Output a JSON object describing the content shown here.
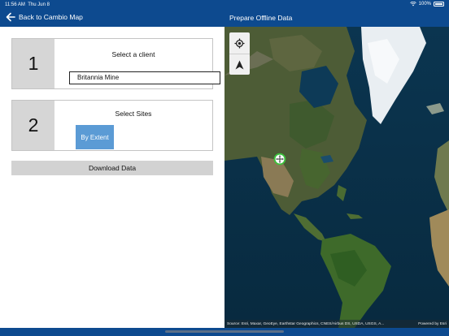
{
  "status_bar": {
    "time": "11:56 AM",
    "date": "Thu Jun 8",
    "battery": "100%",
    "icons": [
      "wifi-icon",
      "battery-icon"
    ]
  },
  "nav": {
    "back_label": "Back to Cambio Map",
    "title": "Prepare Offline Data",
    "back_icon": "arrow-left-icon"
  },
  "steps": [
    {
      "number": "1",
      "label": "Select a client",
      "field_value": "Britannia Mine"
    },
    {
      "number": "2",
      "label": "Select Sites",
      "button_label": "By Extent"
    }
  ],
  "download_label": "Download Data",
  "map": {
    "tools": [
      "locate-icon",
      "compass-icon"
    ],
    "marker_icon": "pan-marker-icon",
    "attribution": "Source: Esri, Maxar, GeoEye, Earthstar Geographics, CNES/Airbus DS, USDA, USGS, A...",
    "powered_by": "Powered by Esri"
  },
  "colors": {
    "chrome": "#0d4a8f",
    "step_number_bg": "#d6d6d6",
    "extent_button": "#5b9bd5",
    "download_button": "#d2d2d2",
    "marker": "#3cc23c"
  }
}
